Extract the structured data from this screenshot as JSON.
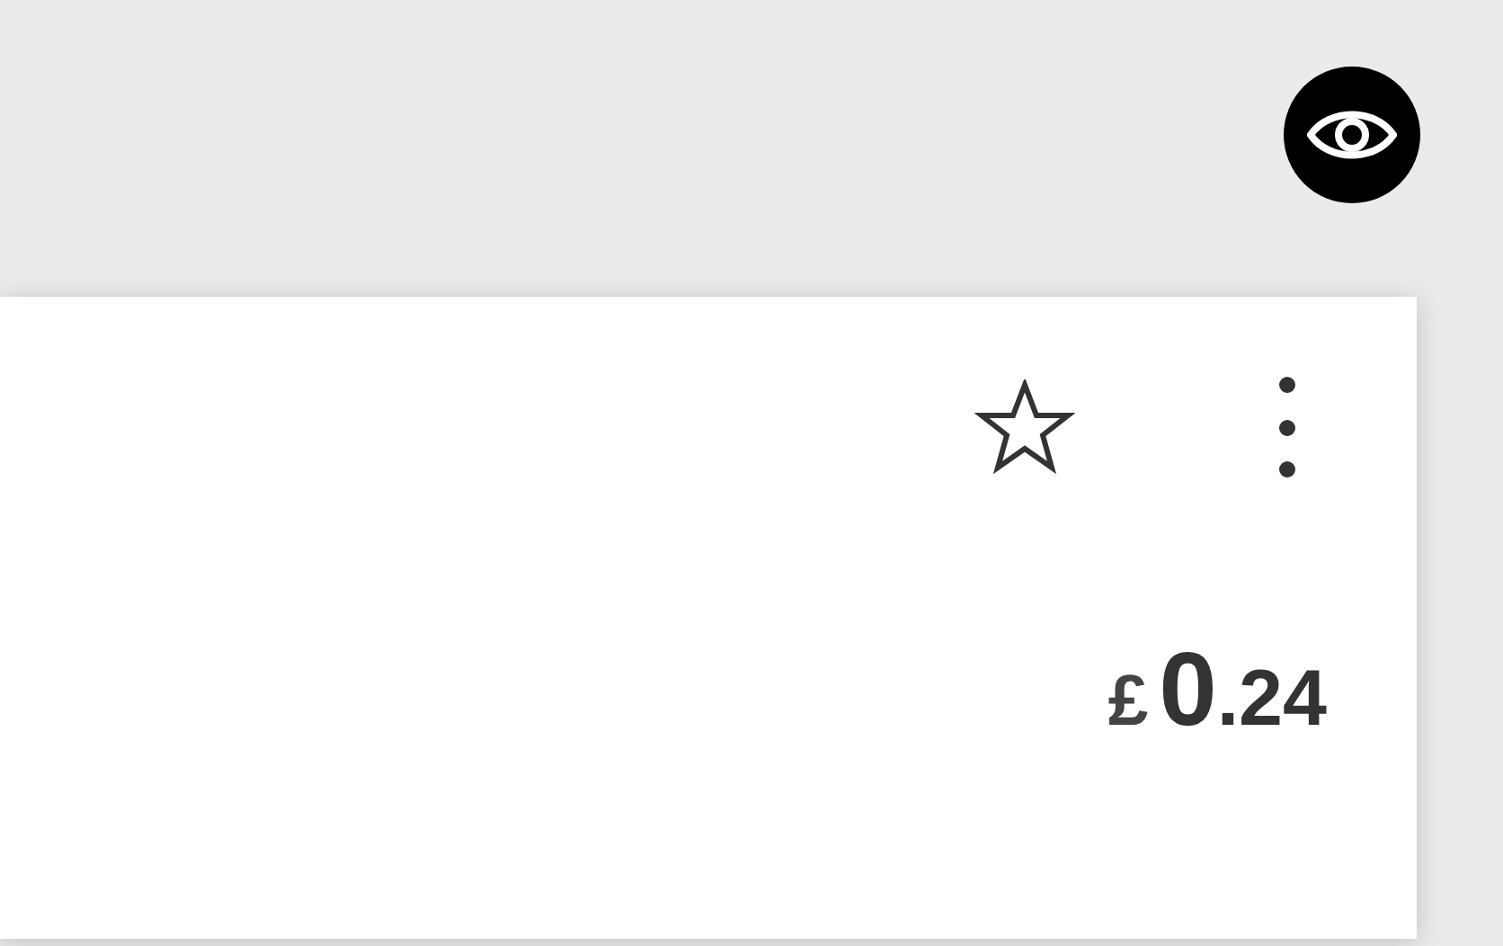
{
  "card": {
    "starred": false,
    "price": {
      "currency": "£",
      "whole": "0",
      "fraction": ".24"
    }
  }
}
